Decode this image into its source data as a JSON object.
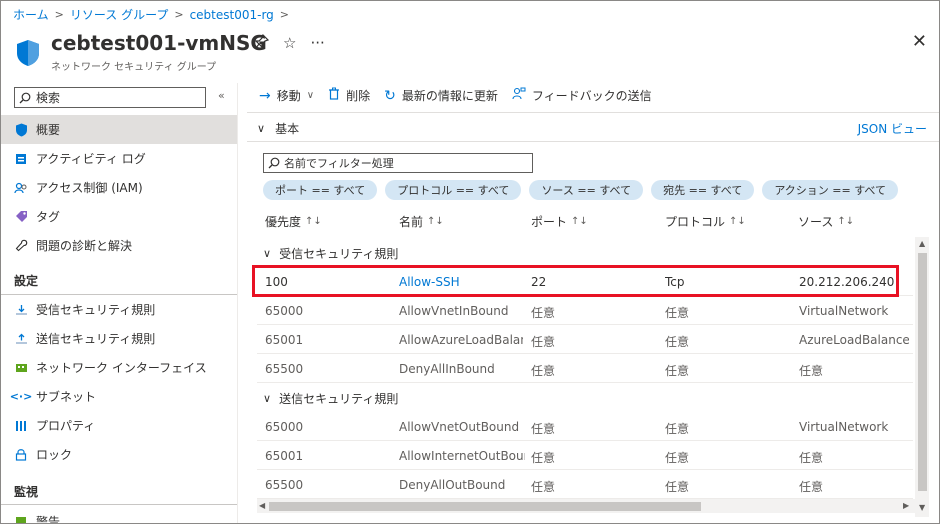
{
  "breadcrumb": {
    "home": "ホーム",
    "resource_groups": "リソース グループ",
    "rg": "cebtest001-rg"
  },
  "header": {
    "title": "cebtest001-vmNSG",
    "subtitle": "ネットワーク セキュリティ グループ",
    "pin_icon": "pin-icon",
    "star_icon": "star-icon",
    "more": "···",
    "close": "✕"
  },
  "sidebar": {
    "search_placeholder": "検索",
    "collapse": "«",
    "items": [
      {
        "label": "概要",
        "icon": "shield-icon",
        "active": true
      },
      {
        "label": "アクティビティ ログ",
        "icon": "log-icon"
      },
      {
        "label": "アクセス制御 (IAM)",
        "icon": "iam-icon"
      },
      {
        "label": "タグ",
        "icon": "tag-icon"
      },
      {
        "label": "問題の診断と解決",
        "icon": "wrench-icon"
      }
    ],
    "section_settings": "設定",
    "settings_items": [
      {
        "label": "受信セキュリティ規則",
        "icon": "inbound-icon"
      },
      {
        "label": "送信セキュリティ規則",
        "icon": "outbound-icon"
      },
      {
        "label": "ネットワーク インターフェイス",
        "icon": "nic-icon"
      },
      {
        "label": "サブネット",
        "icon": "subnet-icon"
      },
      {
        "label": "プロパティ",
        "icon": "properties-icon"
      },
      {
        "label": "ロック",
        "icon": "lock-icon"
      }
    ],
    "section_monitoring": "監視",
    "monitoring_items": [
      {
        "label": "警告",
        "icon": "alert-icon"
      }
    ]
  },
  "toolbar": {
    "move": "移動",
    "delete": "削除",
    "refresh": "最新の情報に更新",
    "feedback": "フィードバックの送信"
  },
  "essentials": {
    "label": "基本",
    "json_view": "JSON ビュー"
  },
  "filter": {
    "placeholder": "名前でフィルター処理",
    "pills": [
      "ポート == すべて",
      "プロトコル == すべて",
      "ソース == すべて",
      "宛先 == すべて",
      "アクション == すべて"
    ]
  },
  "table": {
    "columns": [
      "優先度",
      "名前",
      "ポート",
      "プロトコル",
      "ソース"
    ],
    "sort_glyph": "↑↓",
    "inbound_group": "受信セキュリティ規則",
    "outbound_group": "送信セキュリティ規則",
    "inbound_rows": [
      [
        "100",
        "Allow-SSH",
        "22",
        "Tcp",
        "20.212.206.240"
      ],
      [
        "65000",
        "AllowVnetInBound",
        "任意",
        "任意",
        "VirtualNetwork"
      ],
      [
        "65001",
        "AllowAzureLoadBalan…",
        "任意",
        "任意",
        "AzureLoadBalancer"
      ],
      [
        "65500",
        "DenyAllInBound",
        "任意",
        "任意",
        "任意"
      ]
    ],
    "outbound_rows": [
      [
        "65000",
        "AllowVnetOutBound",
        "任意",
        "任意",
        "VirtualNetwork"
      ],
      [
        "65001",
        "AllowInternetOutBound",
        "任意",
        "任意",
        "任意"
      ],
      [
        "65500",
        "DenyAllOutBound",
        "任意",
        "任意",
        "任意"
      ]
    ]
  },
  "colors": {
    "accent": "#0078d4",
    "highlight": "#e81123",
    "pill": "#d4e6f4",
    "active_nav": "#e1dfdd"
  }
}
